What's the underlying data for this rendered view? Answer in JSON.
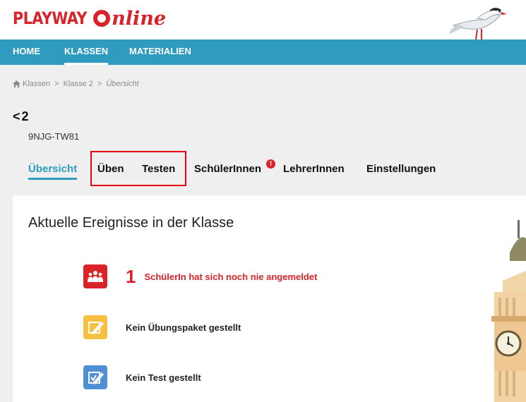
{
  "logo": {
    "brand": "PLAYWAY",
    "product": "nline"
  },
  "nav": {
    "items": [
      {
        "label": "HOME"
      },
      {
        "label": "KLASSEN"
      },
      {
        "label": "MATERIALIEN"
      }
    ]
  },
  "breadcrumb": {
    "items": [
      "Klassen",
      "Klasse 2",
      "Übersicht"
    ],
    "separator": ">"
  },
  "class": {
    "back_glyph": "<",
    "number": "2",
    "code": "9NJG-TW81"
  },
  "tabs": [
    {
      "label": "Übersicht"
    },
    {
      "label": "Üben"
    },
    {
      "label": "Testen"
    },
    {
      "label": "SchülerInnen",
      "alert": "!"
    },
    {
      "label": "LehrerInnen"
    },
    {
      "label": "Einstellungen"
    }
  ],
  "main": {
    "title": "Aktuelle Ereignisse in der Klasse",
    "events": [
      {
        "icon": "students-icon",
        "count": "1",
        "text": "SchülerIn hat sich noch nie angemeldet"
      },
      {
        "icon": "exercise-package-icon",
        "text": "Kein Übungspaket gestellt"
      },
      {
        "icon": "test-icon",
        "text": "Kein Test gestellt"
      }
    ]
  },
  "colors": {
    "brand_red": "#d8232a",
    "nav_blue": "#2e9bbf",
    "highlight_red": "#e3000f"
  }
}
